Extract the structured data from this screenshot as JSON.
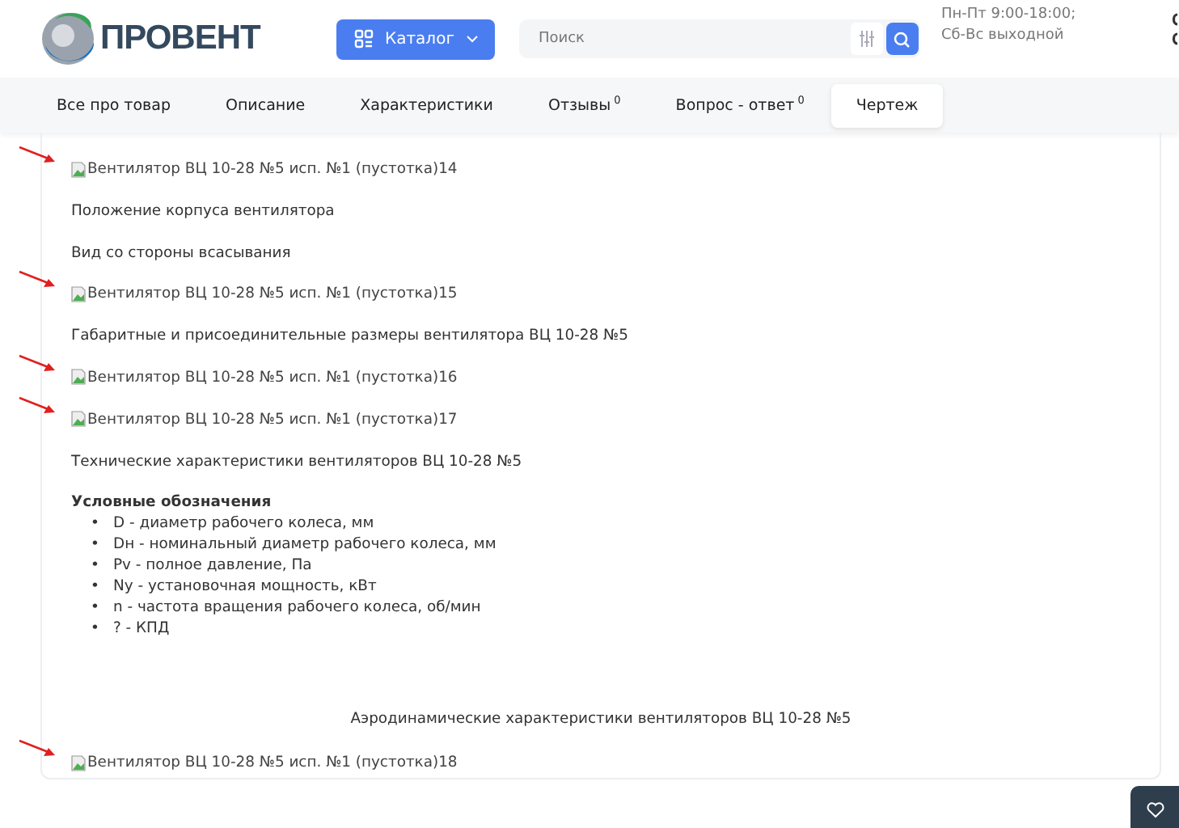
{
  "header": {
    "logo": "ПРОВЕНТ",
    "catalog_button": "Каталог",
    "search": {
      "placeholder": "Поиск"
    },
    "hours": [
      "Пн-Пт 9:00-18:00;",
      "Сб-Вс выходной"
    ]
  },
  "tabs": [
    {
      "label": "Все про товар",
      "selected": false
    },
    {
      "label": "Описание",
      "selected": false
    },
    {
      "label": "Характеристики",
      "selected": false
    },
    {
      "label": "Отзывы",
      "count": "0",
      "selected": false
    },
    {
      "label": "Вопрос - ответ",
      "count": "0",
      "selected": false
    },
    {
      "label": "Чертеж",
      "selected": true
    }
  ],
  "content": [
    {
      "kind": "image",
      "text": "Вентилятор ВЦ 10-28 №5 исп. №1 (пустотка)14",
      "annotated": true
    },
    {
      "kind": "text",
      "text": "Положение корпуса вентилятора"
    },
    {
      "kind": "text",
      "text": "Вид со стороны всасывания"
    },
    {
      "kind": "image",
      "text": "Вентилятор ВЦ 10-28 №5 исп. №1 (пустотка)15",
      "annotated": true
    },
    {
      "kind": "text",
      "text": "Габаритные и присоединительные размеры вентилятора ВЦ 10-28 №5"
    },
    {
      "kind": "image",
      "text": "Вентилятор ВЦ 10-28 №5 исп. №1 (пустотка)16",
      "annotated": true
    },
    {
      "kind": "image",
      "text": "Вентилятор ВЦ 10-28 №5 исп. №1 (пустотка)17",
      "annotated": true
    },
    {
      "kind": "text",
      "text": "Технические характеристики вентиляторов ВЦ 10-28 №5"
    },
    {
      "kind": "heading",
      "text": "Условные обозначения"
    },
    {
      "kind": "list",
      "marker": "•",
      "items": [
        "D - диаметр рабочего колеса, мм",
        "Dн - номинальный диаметр рабочего колеса, мм",
        "Pv - полное давление, Па",
        "Nу - установочная мощность, кВт",
        "n - частота вращения рабочего колеса, об/мин",
        "? - КПД"
      ]
    },
    {
      "kind": "caption",
      "text": "Аэродинамические характеристики вентиляторов ВЦ 10-28 №5"
    },
    {
      "kind": "image",
      "text": "Вентилятор ВЦ 10-28 №5 исп. №1 (пустотка)18",
      "annotated": true
    }
  ]
}
